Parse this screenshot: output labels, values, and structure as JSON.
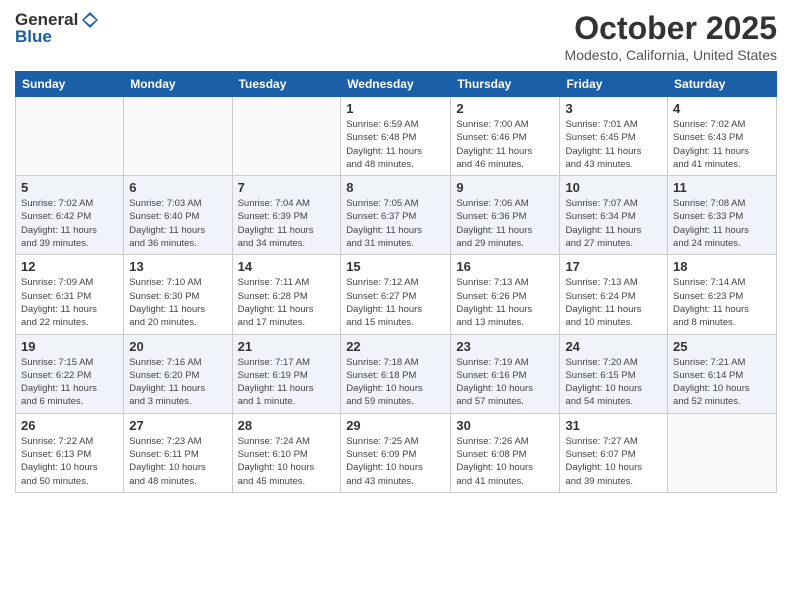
{
  "header": {
    "logo_line1": "General",
    "logo_line2": "Blue",
    "month": "October 2025",
    "location": "Modesto, California, United States"
  },
  "weekdays": [
    "Sunday",
    "Monday",
    "Tuesday",
    "Wednesday",
    "Thursday",
    "Friday",
    "Saturday"
  ],
  "weeks": [
    [
      {
        "day": "",
        "info": ""
      },
      {
        "day": "",
        "info": ""
      },
      {
        "day": "",
        "info": ""
      },
      {
        "day": "1",
        "info": "Sunrise: 6:59 AM\nSunset: 6:48 PM\nDaylight: 11 hours\nand 48 minutes."
      },
      {
        "day": "2",
        "info": "Sunrise: 7:00 AM\nSunset: 6:46 PM\nDaylight: 11 hours\nand 46 minutes."
      },
      {
        "day": "3",
        "info": "Sunrise: 7:01 AM\nSunset: 6:45 PM\nDaylight: 11 hours\nand 43 minutes."
      },
      {
        "day": "4",
        "info": "Sunrise: 7:02 AM\nSunset: 6:43 PM\nDaylight: 11 hours\nand 41 minutes."
      }
    ],
    [
      {
        "day": "5",
        "info": "Sunrise: 7:02 AM\nSunset: 6:42 PM\nDaylight: 11 hours\nand 39 minutes."
      },
      {
        "day": "6",
        "info": "Sunrise: 7:03 AM\nSunset: 6:40 PM\nDaylight: 11 hours\nand 36 minutes."
      },
      {
        "day": "7",
        "info": "Sunrise: 7:04 AM\nSunset: 6:39 PM\nDaylight: 11 hours\nand 34 minutes."
      },
      {
        "day": "8",
        "info": "Sunrise: 7:05 AM\nSunset: 6:37 PM\nDaylight: 11 hours\nand 31 minutes."
      },
      {
        "day": "9",
        "info": "Sunrise: 7:06 AM\nSunset: 6:36 PM\nDaylight: 11 hours\nand 29 minutes."
      },
      {
        "day": "10",
        "info": "Sunrise: 7:07 AM\nSunset: 6:34 PM\nDaylight: 11 hours\nand 27 minutes."
      },
      {
        "day": "11",
        "info": "Sunrise: 7:08 AM\nSunset: 6:33 PM\nDaylight: 11 hours\nand 24 minutes."
      }
    ],
    [
      {
        "day": "12",
        "info": "Sunrise: 7:09 AM\nSunset: 6:31 PM\nDaylight: 11 hours\nand 22 minutes."
      },
      {
        "day": "13",
        "info": "Sunrise: 7:10 AM\nSunset: 6:30 PM\nDaylight: 11 hours\nand 20 minutes."
      },
      {
        "day": "14",
        "info": "Sunrise: 7:11 AM\nSunset: 6:28 PM\nDaylight: 11 hours\nand 17 minutes."
      },
      {
        "day": "15",
        "info": "Sunrise: 7:12 AM\nSunset: 6:27 PM\nDaylight: 11 hours\nand 15 minutes."
      },
      {
        "day": "16",
        "info": "Sunrise: 7:13 AM\nSunset: 6:26 PM\nDaylight: 11 hours\nand 13 minutes."
      },
      {
        "day": "17",
        "info": "Sunrise: 7:13 AM\nSunset: 6:24 PM\nDaylight: 11 hours\nand 10 minutes."
      },
      {
        "day": "18",
        "info": "Sunrise: 7:14 AM\nSunset: 6:23 PM\nDaylight: 11 hours\nand 8 minutes."
      }
    ],
    [
      {
        "day": "19",
        "info": "Sunrise: 7:15 AM\nSunset: 6:22 PM\nDaylight: 11 hours\nand 6 minutes."
      },
      {
        "day": "20",
        "info": "Sunrise: 7:16 AM\nSunset: 6:20 PM\nDaylight: 11 hours\nand 3 minutes."
      },
      {
        "day": "21",
        "info": "Sunrise: 7:17 AM\nSunset: 6:19 PM\nDaylight: 11 hours\nand 1 minute."
      },
      {
        "day": "22",
        "info": "Sunrise: 7:18 AM\nSunset: 6:18 PM\nDaylight: 10 hours\nand 59 minutes."
      },
      {
        "day": "23",
        "info": "Sunrise: 7:19 AM\nSunset: 6:16 PM\nDaylight: 10 hours\nand 57 minutes."
      },
      {
        "day": "24",
        "info": "Sunrise: 7:20 AM\nSunset: 6:15 PM\nDaylight: 10 hours\nand 54 minutes."
      },
      {
        "day": "25",
        "info": "Sunrise: 7:21 AM\nSunset: 6:14 PM\nDaylight: 10 hours\nand 52 minutes."
      }
    ],
    [
      {
        "day": "26",
        "info": "Sunrise: 7:22 AM\nSunset: 6:13 PM\nDaylight: 10 hours\nand 50 minutes."
      },
      {
        "day": "27",
        "info": "Sunrise: 7:23 AM\nSunset: 6:11 PM\nDaylight: 10 hours\nand 48 minutes."
      },
      {
        "day": "28",
        "info": "Sunrise: 7:24 AM\nSunset: 6:10 PM\nDaylight: 10 hours\nand 45 minutes."
      },
      {
        "day": "29",
        "info": "Sunrise: 7:25 AM\nSunset: 6:09 PM\nDaylight: 10 hours\nand 43 minutes."
      },
      {
        "day": "30",
        "info": "Sunrise: 7:26 AM\nSunset: 6:08 PM\nDaylight: 10 hours\nand 41 minutes."
      },
      {
        "day": "31",
        "info": "Sunrise: 7:27 AM\nSunset: 6:07 PM\nDaylight: 10 hours\nand 39 minutes."
      },
      {
        "day": "",
        "info": ""
      }
    ]
  ]
}
